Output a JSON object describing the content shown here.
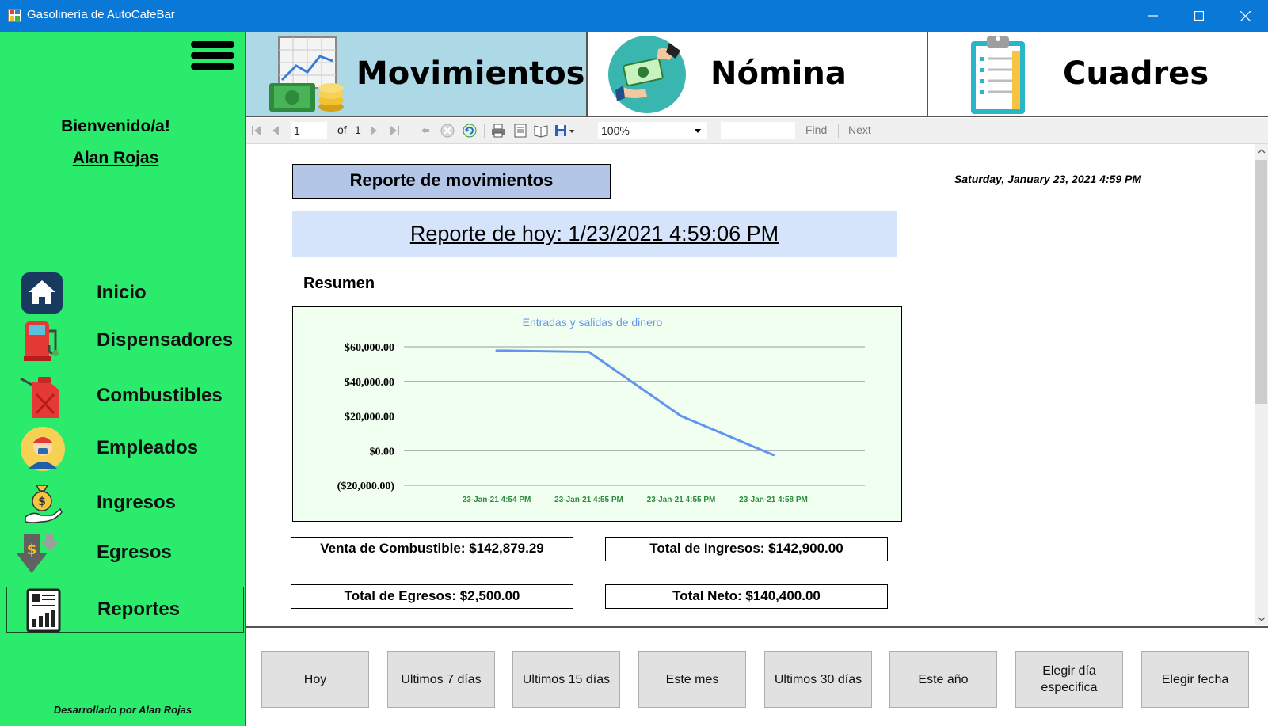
{
  "window": {
    "title": "Gasolinería de AutoCafeBar",
    "controls": {
      "minimize": "—",
      "maximize": "☐",
      "close": "✕"
    }
  },
  "sidebar": {
    "welcome": "Bienvenido/a!",
    "username": "Alan Rojas",
    "items": [
      {
        "label": "Inicio",
        "icon": "home-icon"
      },
      {
        "label": "Dispensadores",
        "icon": "fuel-pump-icon"
      },
      {
        "label": "Combustibles",
        "icon": "jerrycan-icon"
      },
      {
        "label": "Empleados",
        "icon": "employee-icon"
      },
      {
        "label": "Ingresos",
        "icon": "money-bag-icon"
      },
      {
        "label": "Egresos",
        "icon": "money-down-icon"
      },
      {
        "label": "Reportes",
        "icon": "report-icon"
      }
    ],
    "active_item": "Reportes",
    "credit": "Desarrollado por Alan Rojas"
  },
  "tabs": [
    {
      "label": "Movimientos",
      "icon": "money-chart-icon",
      "active": true
    },
    {
      "label": "Nómina",
      "icon": "payroll-icon",
      "active": false
    },
    {
      "label": "Cuadres",
      "icon": "clipboard-icon",
      "active": false
    }
  ],
  "colors": {
    "sidebar_bg": "#2beb6d",
    "active_tab_bg": "#add8e6",
    "titlebar": "#0a78d7",
    "chart_line": "#6495ed"
  },
  "toolbar": {
    "page": "1",
    "of_label": "of",
    "total_pages": "1",
    "zoom": "100%",
    "find_label": "Find",
    "next_label": "Next"
  },
  "report": {
    "title": "Reporte de movimientos",
    "date": "Saturday, January 23, 2021 4:59 PM",
    "today_label": "Reporte de hoy: 1/23/2021 4:59:06 PM",
    "section": "Resumen",
    "stats": {
      "fuel_sales": "Venta de Combustible: $142,879.29",
      "total_income": "Total de Ingresos: $142,900.00",
      "total_expenses": "Total de Egresos: $2,500.00",
      "net_total": "Total Neto: $140,400.00"
    },
    "stat_colors": {
      "fuel_sales": "#f5e68c",
      "total_income": "#add8e6",
      "total_expenses": "#ffc0cb",
      "net_total": "#f0fff0"
    }
  },
  "chart_data": {
    "type": "line",
    "title": "Entradas y salidas de dinero",
    "categories": [
      "23-Jan-21 4:54 PM",
      "23-Jan-21 4:55 PM",
      "23-Jan-21 4:55 PM",
      "23-Jan-21 4:58 PM"
    ],
    "series": [
      {
        "values": [
          57800,
          57000,
          20000,
          -2500
        ]
      }
    ],
    "yticks": [
      "$60,000.00",
      "$40,000.00",
      "$20,000.00",
      "$0.00",
      "($20,000.00)"
    ],
    "ylim": [
      -20000,
      60000
    ],
    "grid": true,
    "legend": "none"
  },
  "buttons": [
    "Hoy",
    "Ultimos 7 días",
    "Ultimos 15 días",
    "Este mes",
    "Ultimos 30 días",
    "Este año",
    "Elegir día especifica",
    "Elegir fecha"
  ]
}
